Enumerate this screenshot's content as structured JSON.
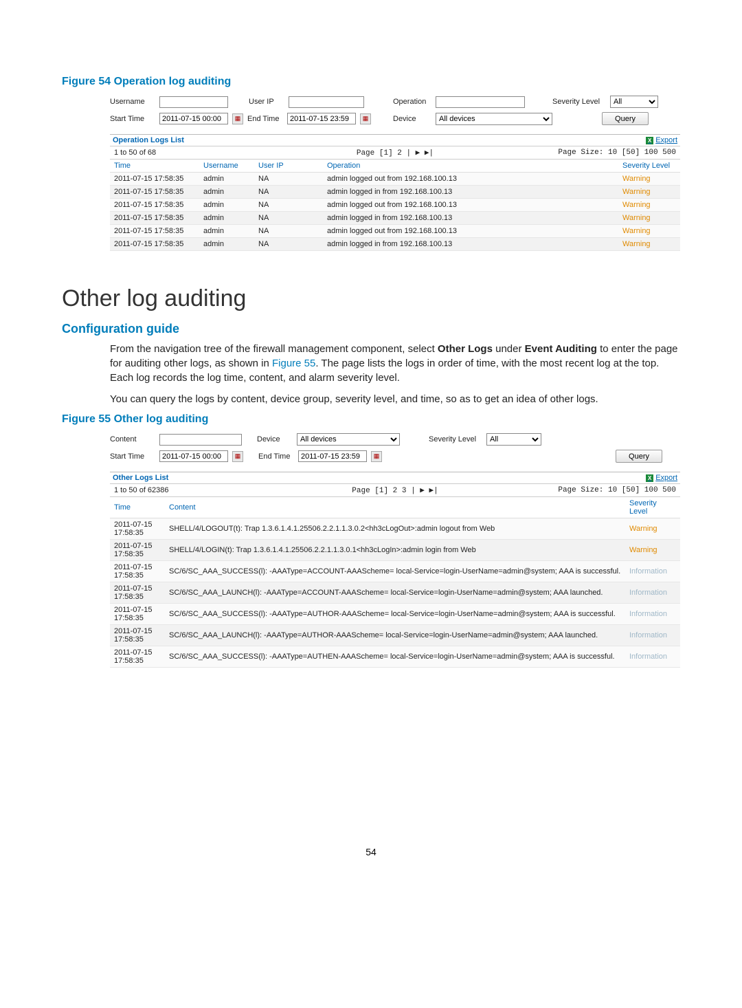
{
  "figure54": {
    "caption": "Figure 54 Operation log auditing",
    "filters": {
      "usernameLabel": "Username",
      "userIPLabel": "User IP",
      "operationLabel": "Operation",
      "severityLabel": "Severity Level",
      "severityValue": "All",
      "startTimeLabel": "Start Time",
      "startTimeValue": "2011-07-15 00:00",
      "endTimeLabel": "End Time",
      "endTimeValue": "2011-07-15 23:59",
      "deviceLabel": "Device",
      "deviceValue": "All devices",
      "queryLabel": "Query"
    },
    "listTitle": "Operation Logs List",
    "exportLabel": "Export",
    "pager": {
      "range": "1 to 50 of 68",
      "pagesHtml": "Page [1] 2 | ▶ ▶|",
      "pageSizeHtml": "Page Size: 10 [50] 100 500"
    },
    "columns": {
      "time": "Time",
      "username": "Username",
      "userip": "User IP",
      "operation": "Operation",
      "severity": "Severity Level"
    },
    "rows": [
      {
        "time": "2011-07-15 17:58:35",
        "user": "admin",
        "ip": "NA",
        "op": "admin logged out from 192.168.100.13",
        "sev": "Warning"
      },
      {
        "time": "2011-07-15 17:58:35",
        "user": "admin",
        "ip": "NA",
        "op": "admin logged in from 192.168.100.13",
        "sev": "Warning"
      },
      {
        "time": "2011-07-15 17:58:35",
        "user": "admin",
        "ip": "NA",
        "op": "admin logged out from 192.168.100.13",
        "sev": "Warning"
      },
      {
        "time": "2011-07-15 17:58:35",
        "user": "admin",
        "ip": "NA",
        "op": "admin logged in from 192.168.100.13",
        "sev": "Warning"
      },
      {
        "time": "2011-07-15 17:58:35",
        "user": "admin",
        "ip": "NA",
        "op": "admin logged out from 192.168.100.13",
        "sev": "Warning"
      },
      {
        "time": "2011-07-15 17:58:35",
        "user": "admin",
        "ip": "NA",
        "op": "admin logged in from 192.168.100.13",
        "sev": "Warning"
      }
    ]
  },
  "section": {
    "title": "Other log auditing",
    "sub": "Configuration guide",
    "p1a": "From the navigation tree of the firewall management component, select ",
    "p1b": "Other Logs",
    "p1c": " under ",
    "p1d": "Event Auditing",
    "p1e": " to enter the page for auditing other logs, as shown in ",
    "p1link": "Figure 55",
    "p1f": ". The page lists the logs in order of time, with the most recent log at the top. Each log records the log time, content, and alarm severity level.",
    "p2": "You can query the logs by content, device group, severity level, and time, so as to get an idea of other logs."
  },
  "figure55": {
    "caption": "Figure 55 Other log auditing",
    "filters": {
      "contentLabel": "Content",
      "deviceLabel": "Device",
      "deviceValue": "All devices",
      "severityLabel": "Severity Level",
      "severityValue": "All",
      "startTimeLabel": "Start Time",
      "startTimeValue": "2011-07-15 00:00",
      "endTimeLabel": "End Time",
      "endTimeValue": "2011-07-15 23:59",
      "queryLabel": "Query"
    },
    "listTitle": "Other Logs List",
    "exportLabel": "Export",
    "pager": {
      "range": "1 to 50 of 62386",
      "pagesHtml": "Page [1] 2 3 | ▶ ▶|",
      "pageSizeHtml": "Page Size: 10 [50] 100 500"
    },
    "columns": {
      "time": "Time",
      "content": "Content",
      "severity": "Severity Level"
    },
    "rows": [
      {
        "time": "2011-07-15 17:58:35",
        "content": "SHELL/4/LOGOUT(t):   Trap 1.3.6.1.4.1.25506.2.2.1.1.3.0.2<hh3cLogOut>:admin logout from Web",
        "sev": "Warning",
        "sevClass": "sev-warning"
      },
      {
        "time": "2011-07-15 17:58:35",
        "content": "SHELL/4/LOGIN(t):   Trap 1.3.6.1.4.1.25506.2.2.1.1.3.0.1<hh3cLogIn>:admin login from Web",
        "sev": "Warning",
        "sevClass": "sev-warning"
      },
      {
        "time": "2011-07-15 17:58:35",
        "content": "SC/6/SC_AAA_SUCCESS(l): -AAAType=ACCOUNT-AAAScheme= local-Service=login-UserName=admin@system; AAA is successful.",
        "sev": "Information",
        "sevClass": "sev-info"
      },
      {
        "time": "2011-07-15 17:58:35",
        "content": "SC/6/SC_AAA_LAUNCH(l): -AAAType=ACCOUNT-AAAScheme= local-Service=login-UserName=admin@system; AAA launched.",
        "sev": "Information",
        "sevClass": "sev-info"
      },
      {
        "time": "2011-07-15 17:58:35",
        "content": "SC/6/SC_AAA_SUCCESS(l): -AAAType=AUTHOR-AAAScheme= local-Service=login-UserName=admin@system; AAA is successful.",
        "sev": "Information",
        "sevClass": "sev-info"
      },
      {
        "time": "2011-07-15 17:58:35",
        "content": "SC/6/SC_AAA_LAUNCH(l): -AAAType=AUTHOR-AAAScheme= local-Service=login-UserName=admin@system; AAA launched.",
        "sev": "Information",
        "sevClass": "sev-info"
      },
      {
        "time": "2011-07-15 17:58:35",
        "content": "SC/6/SC_AAA_SUCCESS(l): -AAAType=AUTHEN-AAAScheme= local-Service=login-UserName=admin@system; AAA is successful.",
        "sev": "Information",
        "sevClass": "sev-info"
      }
    ]
  },
  "pageNumber": "54"
}
